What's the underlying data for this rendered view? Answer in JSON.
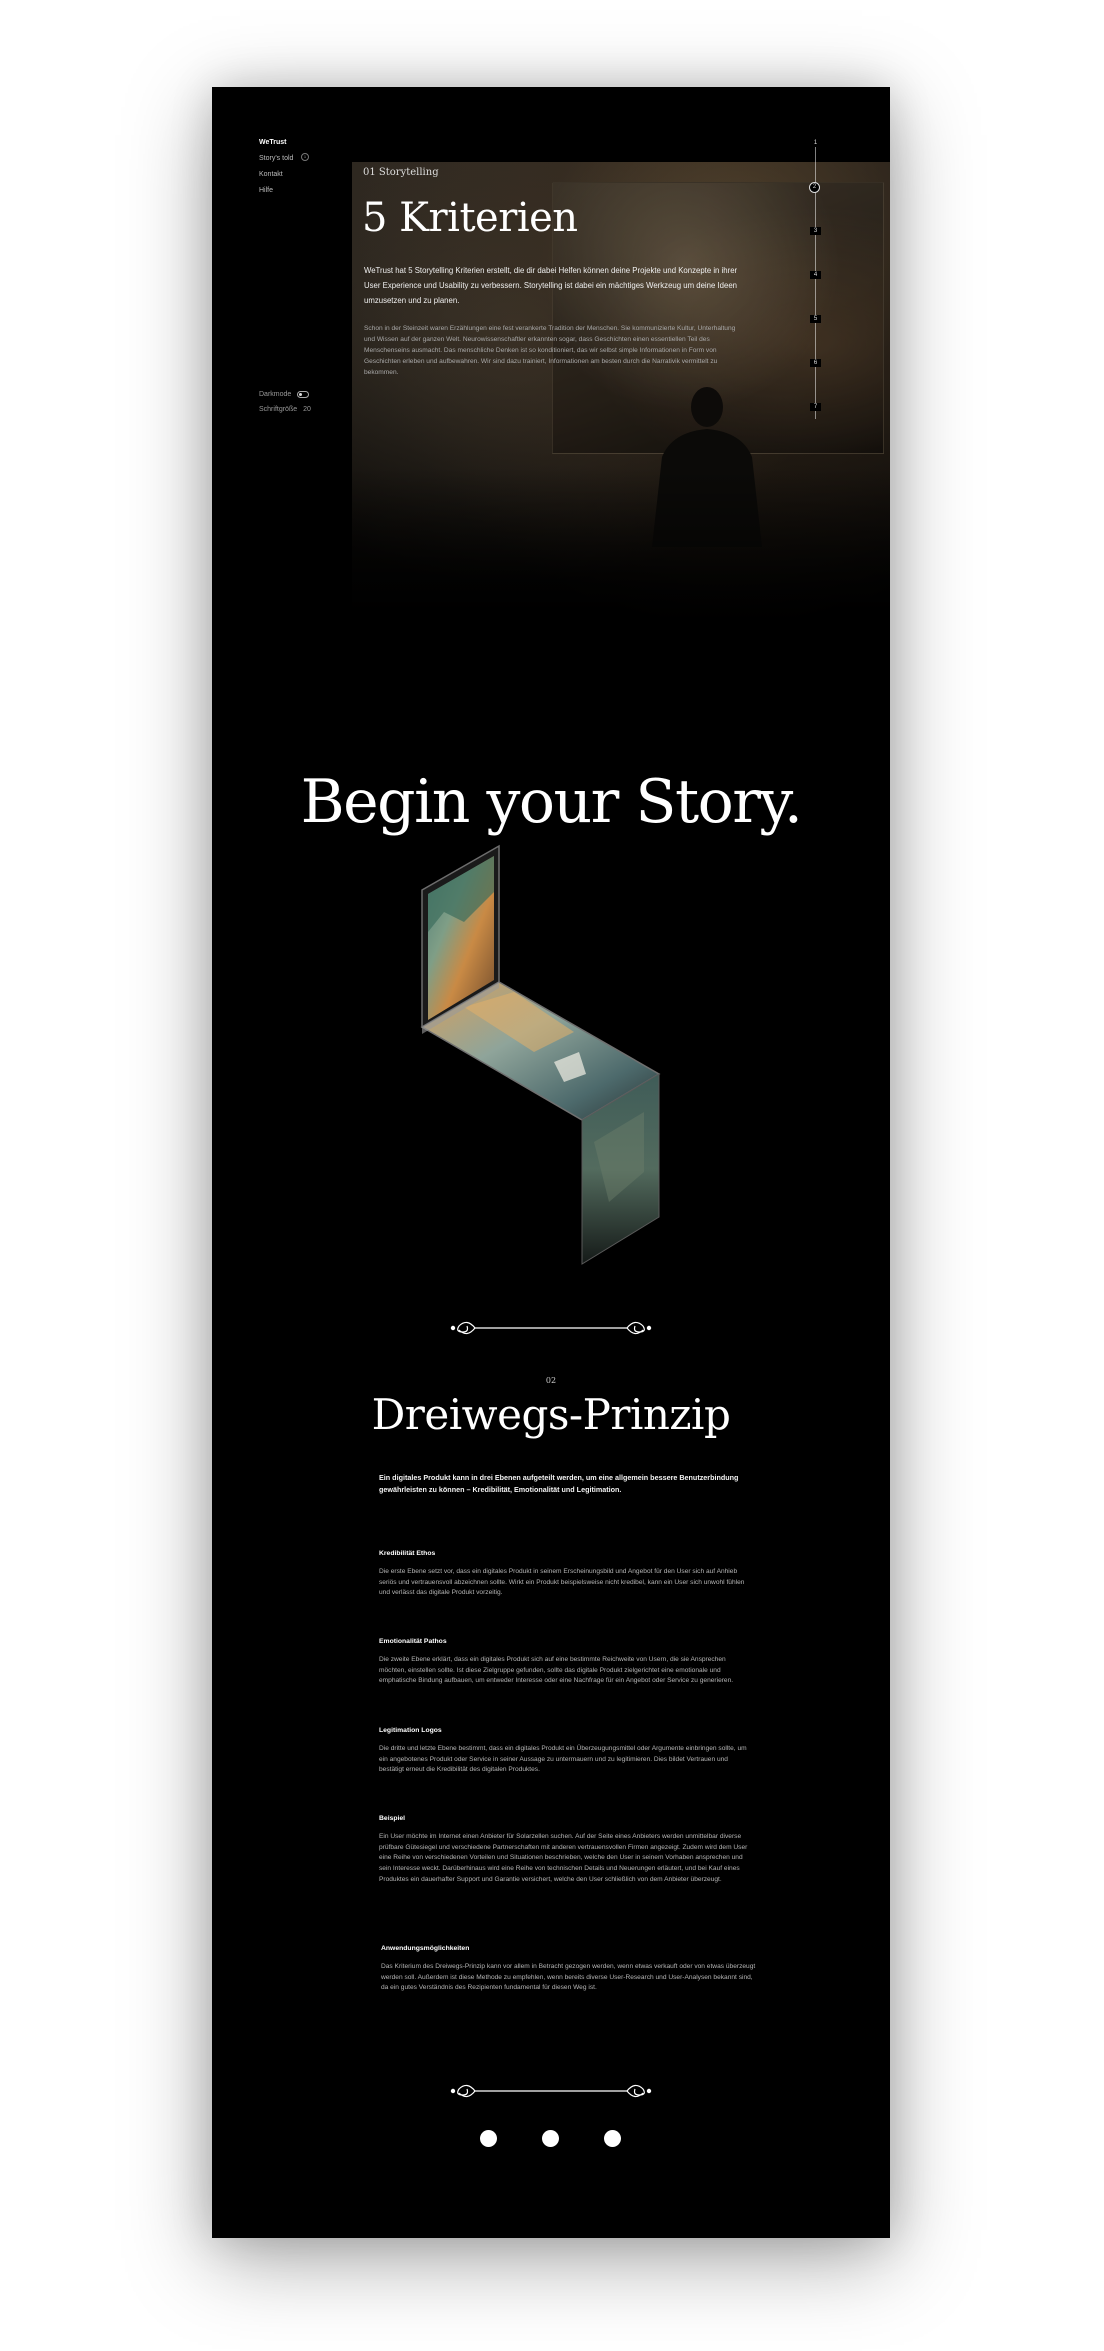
{
  "sidebar": {
    "brand": "WeTrust",
    "items": [
      {
        "label": "Story's told",
        "badge": "1"
      },
      {
        "label": "Kontakt"
      },
      {
        "label": "Hilfe"
      }
    ],
    "darkmode_label": "Darkmode",
    "font_size_label": "Schriftgröße",
    "font_size_value": "20"
  },
  "hero": {
    "kicker": "01 Storytelling",
    "title": "5 Kriterien",
    "lead": "WeTrust hat 5 Storytelling Kriterien erstellt, die dir dabei Helfen können deine Projekte und Konzepte in ihrer User Experience und Usability zu verbessern. Storytelling ist dabei ein mächtiges Werkzeug um deine Ideen umzusetzen und zu planen.",
    "body": "Schon in der Steinzeit waren Erzählungen eine fest verankerte Tradition der Menschen. Sie kommunizierte Kultur, Unterhaltung und Wissen auf der ganzen Welt. Neurowissenschaftler erkannten sogar, dass Geschichten einen essentiellen Teil des Menschenseins ausmacht. Das menschliche Denken ist so konditioniert, das wir selbst simple Informationen in Form von Geschichten erleben und aufbewahren. Wir sind dazu trainiert, Informationen am besten durch die Narrativik vermittelt zu bekommen."
  },
  "progress": {
    "steps": [
      "1",
      "2",
      "3",
      "4",
      "5",
      "6",
      "7"
    ],
    "active": 2
  },
  "story": {
    "headline": "Begin your Story."
  },
  "section2": {
    "number": "02",
    "title": "Dreiwegs-Prinzip",
    "intro": "Ein digitales Produkt kann in drei Ebenen aufgeteilt werden, um eine allgemein bessere Benutzerbindung gewährleisten zu können – Kredibilität, Emotionalität und Legitimation.",
    "blocks": [
      {
        "heading": "Kredibilität Ethos",
        "text": "Die erste Ebene setzt vor, dass ein digitales Produkt in seinem Erscheinungsbild und Angebot für den User sich auf Anhieb seriös und vertrauensvoll abzeichnen sollte. Wirkt ein Produkt beispielsweise nicht kredibel, kann ein User sich unwohl fühlen und verlässt das digitale Produkt vorzeitig."
      },
      {
        "heading": "Emotionalität Pathos",
        "text": "Die zweite Ebene erklärt, dass ein digitales Produkt sich auf eine bestimmte Reichweite von Usern, die sie Ansprechen möchten, einstellen sollte. Ist diese Zielgruppe gefunden, sollte das digitale Produkt zielgerichtet eine emotionale und emphatische Bindung aufbauen, um entweder Interesse oder eine Nachfrage für ein Angebot oder Service zu generieren."
      },
      {
        "heading": "Legitimation Logos",
        "text": "Die dritte und letzte Ebene bestimmt, dass ein digitales Produkt ein Überzeugungsmittel oder Argumente einbringen sollte, um ein angebotenes Produkt oder Service in seiner Aussage zu untermauern und zu legitimieren. Dies bildet Vertrauen und bestätigt erneut die Kredibilität des digitalen Produktes."
      },
      {
        "heading": "Beispiel",
        "text": "Ein User möchte im Internet einen Anbieter für Solarzellen suchen. Auf der Seite eines Anbieters werden unmittelbar diverse prüfbare Gütesiegel und verschiedene Partnerschaften mit anderen vertrauensvollen Firmen angezeigt. Zudem wird dem User eine Reihe von verschiedenen Vorteilen und Situationen beschrieben, welche den User in seinem Vorhaben ansprechen und sein Interesse weckt. Darüberhinaus wird eine Reihe von technischen Details und Neuerungen erläutert, und bei Kauf eines Produktes ein dauerhafter Support und Garantie versichert, welche den User schließlich von dem Anbieter überzeugt."
      },
      {
        "heading": "Anwendungsmöglichkeiten",
        "text": "Das Kriterium des Dreiwegs-Prinzip kann vor allem in Betracht gezogen werden, wenn etwas verkauft oder von etwas überzeugt werden soll. Außerdem ist diese Methode zu empfehlen, wenn bereits diverse User-Research und User-Analysen bekannt sind, da ein gutes Verständnis des Rezipienten fundamental für diesen Weg ist."
      }
    ]
  },
  "pagination": {
    "dots": [
      "dot-1",
      "dot-2",
      "dot-3"
    ]
  },
  "colors": {
    "background": "#000000",
    "page": "#ffffff",
    "text": "#ffffff",
    "muted": "#b5b5b5"
  }
}
